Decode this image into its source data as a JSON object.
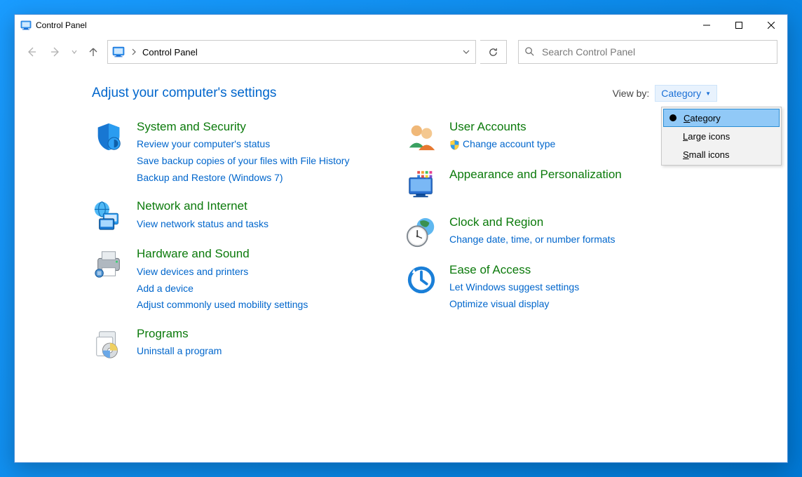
{
  "window": {
    "title": "Control Panel"
  },
  "address": {
    "path": "Control Panel"
  },
  "search": {
    "placeholder": "Search Control Panel"
  },
  "heading": "Adjust your computer's settings",
  "viewby": {
    "label": "View by:",
    "selected": "Category",
    "options": [
      {
        "label": "Category",
        "accel": "C",
        "selected": true
      },
      {
        "label": "Large icons",
        "accel": "L",
        "selected": false
      },
      {
        "label": "Small icons",
        "accel": "S",
        "selected": false
      }
    ]
  },
  "categories": {
    "left": [
      {
        "name": "system-and-security",
        "title": "System and Security",
        "links": [
          "Review your computer's status",
          "Save backup copies of your files with File History",
          "Backup and Restore (Windows 7)"
        ]
      },
      {
        "name": "network-and-internet",
        "title": "Network and Internet",
        "links": [
          "View network status and tasks"
        ]
      },
      {
        "name": "hardware-and-sound",
        "title": "Hardware and Sound",
        "links": [
          "View devices and printers",
          "Add a device",
          "Adjust commonly used mobility settings"
        ]
      },
      {
        "name": "programs",
        "title": "Programs",
        "links": [
          "Uninstall a program"
        ]
      }
    ],
    "right": [
      {
        "name": "user-accounts",
        "title": "User Accounts",
        "links": [
          "Change account type"
        ],
        "shield": true
      },
      {
        "name": "appearance-and-personalization",
        "title": "Appearance and Personalization",
        "links": []
      },
      {
        "name": "clock-and-region",
        "title": "Clock and Region",
        "links": [
          "Change date, time, or number formats"
        ]
      },
      {
        "name": "ease-of-access",
        "title": "Ease of Access",
        "links": [
          "Let Windows suggest settings",
          "Optimize visual display"
        ]
      }
    ]
  }
}
